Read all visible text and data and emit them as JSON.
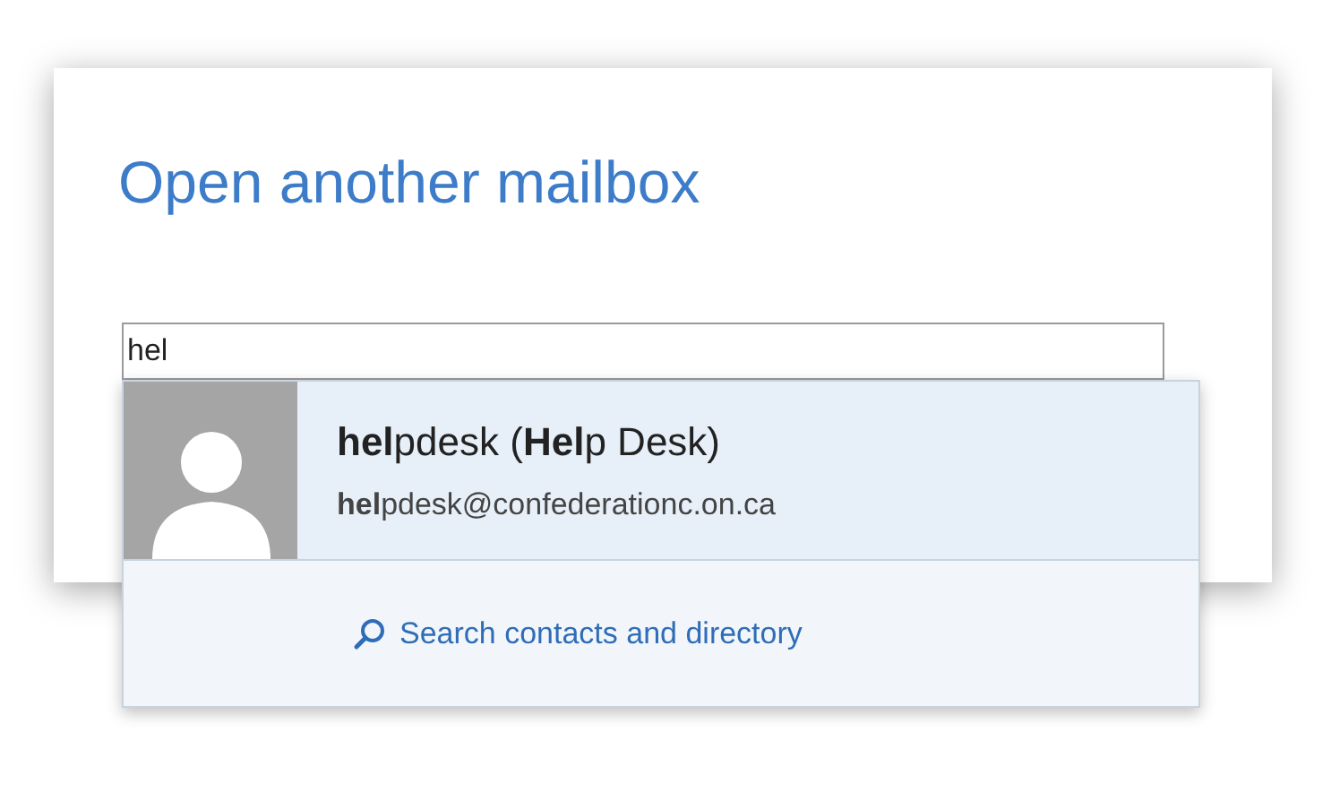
{
  "dialog": {
    "title": "Open another mailbox"
  },
  "mailbox_input": {
    "value": "hel"
  },
  "suggestions": [
    {
      "name": "**hel**pdesk (**Hel**p Desk)",
      "email": "**hel**pdesk@confederationc.on.ca",
      "selected": true
    }
  ],
  "search_link": "Search contacts and directory"
}
